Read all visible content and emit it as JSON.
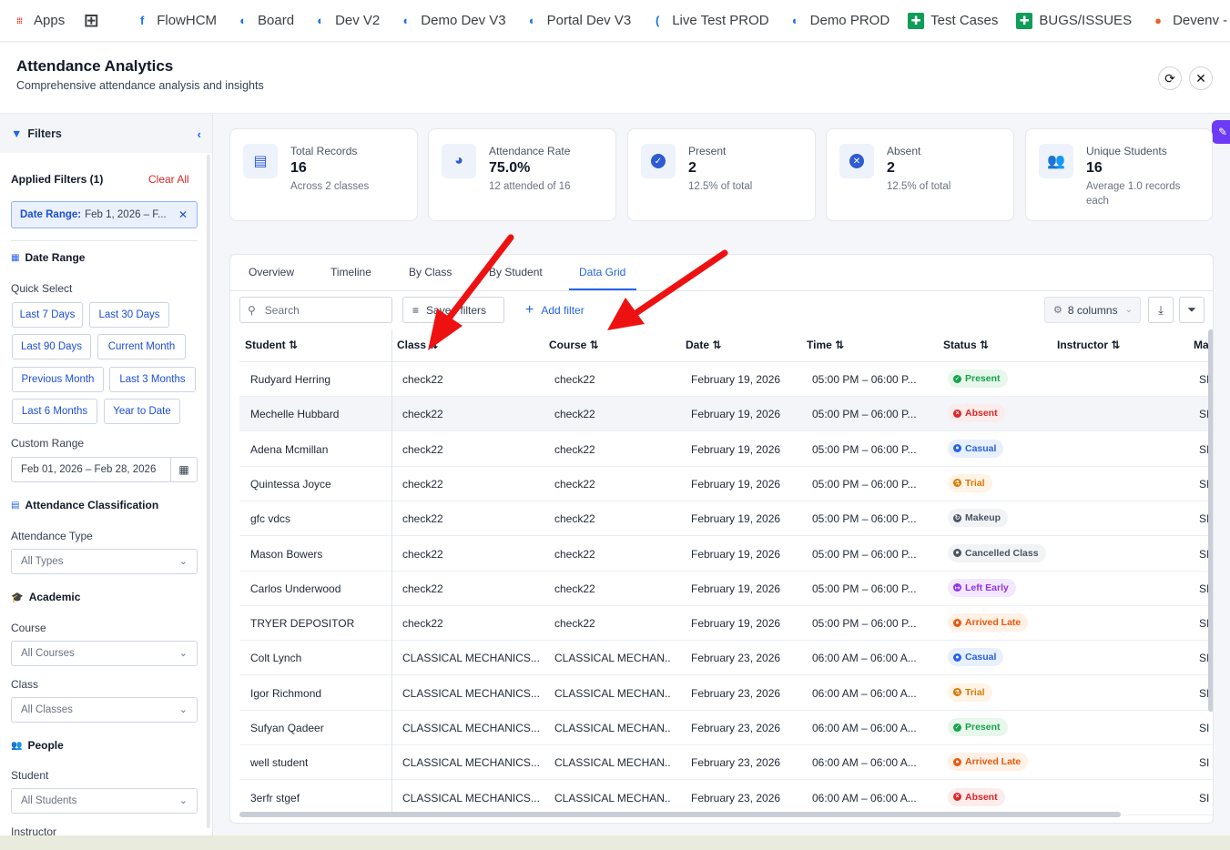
{
  "bookmarks": [
    {
      "label": "Apps",
      "icon": "apps-grid-icon",
      "color": "#ea4335"
    },
    {
      "label": "",
      "icon": "grid-squares-icon",
      "color": "#3c4043"
    },
    {
      "label": "FlowHCM",
      "icon": "facebook-icon",
      "color": "#1877f2"
    },
    {
      "label": "Board",
      "icon": "globe-icon",
      "color": "#1a73e8"
    },
    {
      "label": "Dev V2",
      "icon": "globe-icon",
      "color": "#1a73e8"
    },
    {
      "label": "Demo Dev V3",
      "icon": "globe-icon",
      "color": "#1a73e8"
    },
    {
      "label": "Portal Dev V3",
      "icon": "globe-icon",
      "color": "#1a73e8"
    },
    {
      "label": "Live Test PROD",
      "icon": "loading-icon",
      "color": "#1a73e8"
    },
    {
      "label": "Demo PROD",
      "icon": "globe-icon",
      "color": "#1a73e8"
    },
    {
      "label": "Test Cases",
      "icon": "sheets-icon",
      "color": "#0f9d58"
    },
    {
      "label": "BUGS/ISSUES",
      "icon": "sheets-icon",
      "color": "#0f9d58"
    },
    {
      "label": "Devenv - C",
      "icon": "devenv-icon",
      "color": "#f05a28"
    }
  ],
  "header": {
    "title": "Attendance Analytics",
    "subtitle": "Comprehensive attendance analysis and insights"
  },
  "sidebar": {
    "title": "Filters",
    "applied_label": "Applied Filters (1)",
    "clear_all": "Clear All",
    "applied_chip_key": "Date Range:",
    "applied_chip_value": "Feb 1, 2026 – F...",
    "date_range_title": "Date Range",
    "quick_select_label": "Quick Select",
    "quick": [
      "Last 7 Days",
      "Last 30 Days",
      "Last 90 Days",
      "Current Month",
      "Previous Month",
      "Last 3 Months",
      "Last 6 Months",
      "Year to Date"
    ],
    "custom_range_label": "Custom Range",
    "custom_range_value": "Feb 01, 2026 – Feb 28, 2026",
    "classification_title": "Attendance Classification",
    "attendance_type_label": "Attendance Type",
    "attendance_type_value": "All Types",
    "academic_title": "Academic",
    "course_label": "Course",
    "course_value": "All Courses",
    "class_label": "Class",
    "class_value": "All Classes",
    "people_title": "People",
    "student_label": "Student",
    "student_value": "All Students",
    "instructor_label": "Instructor"
  },
  "stats": [
    {
      "label": "Total Records",
      "value": "16",
      "sub": "Across 2 classes",
      "icon": "clipboard-icon"
    },
    {
      "label": "Attendance Rate",
      "value": "75.0%",
      "sub": "12 attended of 16",
      "icon": "pie-chart-icon"
    },
    {
      "label": "Present",
      "value": "2",
      "sub": "12.5% of total",
      "icon": "check-circle-icon"
    },
    {
      "label": "Absent",
      "value": "2",
      "sub": "12.5% of total",
      "icon": "x-circle-icon"
    },
    {
      "label": "Unique Students",
      "value": "16",
      "sub": "Average 1.0 records each",
      "icon": "users-icon"
    }
  ],
  "tabs": [
    "Overview",
    "Timeline",
    "By Class",
    "By Student",
    "Data Grid"
  ],
  "active_tab": "Data Grid",
  "toolbar": {
    "search_placeholder": "Search",
    "saved_filters": "Saved filters",
    "add_filter": "Add filter",
    "columns": "8 columns"
  },
  "columns": [
    "Student",
    "Class",
    "Course",
    "Date",
    "Time",
    "Status",
    "Instructor",
    "Ma"
  ],
  "rows": [
    {
      "student": "Rudyard Herring",
      "class": "check22",
      "course": "check22",
      "date": "February 19, 2026",
      "time": "05:00 PM – 06:00 P...",
      "status": "Present",
      "extra": "SI"
    },
    {
      "student": "Mechelle Hubbard",
      "class": "check22",
      "course": "check22",
      "date": "February 19, 2026",
      "time": "05:00 PM – 06:00 P...",
      "status": "Absent",
      "extra": "SI"
    },
    {
      "student": "Adena Mcmillan",
      "class": "check22",
      "course": "check22",
      "date": "February 19, 2026",
      "time": "05:00 PM – 06:00 P...",
      "status": "Casual",
      "extra": "SI"
    },
    {
      "student": "Quintessa Joyce",
      "class": "check22",
      "course": "check22",
      "date": "February 19, 2026",
      "time": "05:00 PM – 06:00 P...",
      "status": "Trial",
      "extra": "SI"
    },
    {
      "student": "gfc vdcs",
      "class": "check22",
      "course": "check22",
      "date": "February 19, 2026",
      "time": "05:00 PM – 06:00 P...",
      "status": "Makeup",
      "extra": "SI"
    },
    {
      "student": "Mason Bowers",
      "class": "check22",
      "course": "check22",
      "date": "February 19, 2026",
      "time": "05:00 PM – 06:00 P...",
      "status": "Cancelled Class",
      "extra": "SI"
    },
    {
      "student": "Carlos Underwood",
      "class": "check22",
      "course": "check22",
      "date": "February 19, 2026",
      "time": "05:00 PM – 06:00 P...",
      "status": "Left Early",
      "extra": "SI"
    },
    {
      "student": "TRYER DEPOSITOR",
      "class": "check22",
      "course": "check22",
      "date": "February 19, 2026",
      "time": "05:00 PM – 06:00 P...",
      "status": "Arrived Late",
      "extra": "SI"
    },
    {
      "student": "Colt Lynch",
      "class": "CLASSICAL MECHANICS...",
      "course": "CLASSICAL MECHAN...",
      "date": "February 23, 2026",
      "time": "06:00 AM – 06:00 A...",
      "status": "Casual",
      "extra": "SI"
    },
    {
      "student": "Igor Richmond",
      "class": "CLASSICAL MECHANICS...",
      "course": "CLASSICAL MECHAN...",
      "date": "February 23, 2026",
      "time": "06:00 AM – 06:00 A...",
      "status": "Trial",
      "extra": "SI"
    },
    {
      "student": "Sufyan Qadeer",
      "class": "CLASSICAL MECHANICS...",
      "course": "CLASSICAL MECHAN...",
      "date": "February 23, 2026",
      "time": "06:00 AM – 06:00 A...",
      "status": "Present",
      "extra": "SI"
    },
    {
      "student": "well student",
      "class": "CLASSICAL MECHANICS...",
      "course": "CLASSICAL MECHAN...",
      "date": "February 23, 2026",
      "time": "06:00 AM – 06:00 A...",
      "status": "Arrived Late",
      "extra": "SI"
    },
    {
      "student": "3erfr stgef",
      "class": "CLASSICAL MECHANICS...",
      "course": "CLASSICAL MECHAN...",
      "date": "February 23, 2026",
      "time": "06:00 AM – 06:00 A...",
      "status": "Absent",
      "extra": "SI"
    }
  ],
  "status_styles": {
    "Present": {
      "bg": "#e7f7ec",
      "fg": "#16a34a",
      "glyph": "✓"
    },
    "Absent": {
      "bg": "#fdecec",
      "fg": "#dc2626",
      "glyph": "×"
    },
    "Casual": {
      "bg": "#e8f0fe",
      "fg": "#2563eb",
      "glyph": "●"
    },
    "Trial": {
      "bg": "#fff4e5",
      "fg": "#d97706",
      "glyph": "⚗"
    },
    "Makeup": {
      "bg": "#f1f3f5",
      "fg": "#4b5563",
      "glyph": "↻"
    },
    "Cancelled Class": {
      "bg": "#f1f3f5",
      "fg": "#4b5563",
      "glyph": "●"
    },
    "Left Early": {
      "bg": "#f3e8ff",
      "fg": "#9333ea",
      "glyph": "↦"
    },
    "Arrived Late": {
      "bg": "#fff1e6",
      "fg": "#ea580c",
      "glyph": "●"
    }
  },
  "accent": "#2563eb",
  "arrow_color": "#ee1111"
}
